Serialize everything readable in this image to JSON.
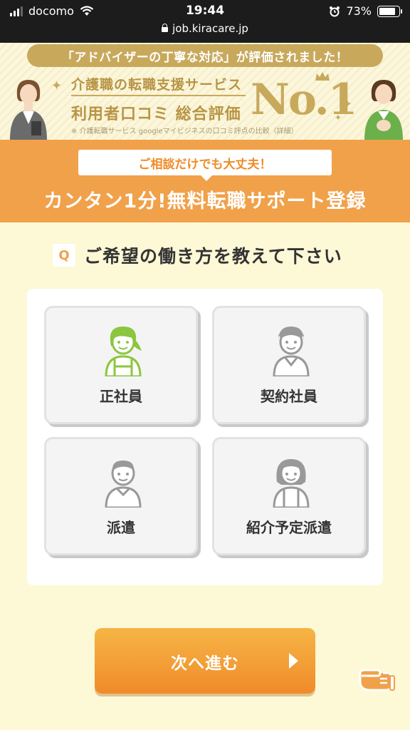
{
  "status_bar": {
    "carrier": "docomo",
    "time": "19:44",
    "battery": "73%",
    "battery_level": 0.73,
    "url": "job.kiracare.jp"
  },
  "banner": {
    "pill": "「アドバイザーの丁寧な対応」が評価されました！",
    "line1": "介護職の転職支援サービス",
    "line2": "利用者口コミ 総合評価",
    "no1": "No.1",
    "note": "※ 介護転職サービス googleマイビジネスの口コミ評点の比較（詳細）"
  },
  "header": {
    "bubble": "ご相談だけでも大丈夫！",
    "title": "カンタン1分!無料転職サポート登録"
  },
  "question": {
    "badge": "Q",
    "text": "ご希望の働き方を教えて下さい"
  },
  "options": [
    {
      "label": "正社員",
      "selected": true
    },
    {
      "label": "契約社員",
      "selected": false
    },
    {
      "label": "派遣",
      "selected": false
    },
    {
      "label": "紹介予定派遣",
      "selected": false
    }
  ],
  "next_button": {
    "label": "次へ進む"
  },
  "colors": {
    "accent_orange": "#f0a14a",
    "gold": "#c8a95c",
    "selected_green": "#8cc63f",
    "background": "#fdf8d6"
  },
  "icons": [
    "signal-icon",
    "wifi-icon",
    "alarm-icon",
    "battery-icon",
    "lock-icon",
    "crown-icon",
    "sparkle-icon",
    "pointing-hand-icon"
  ]
}
